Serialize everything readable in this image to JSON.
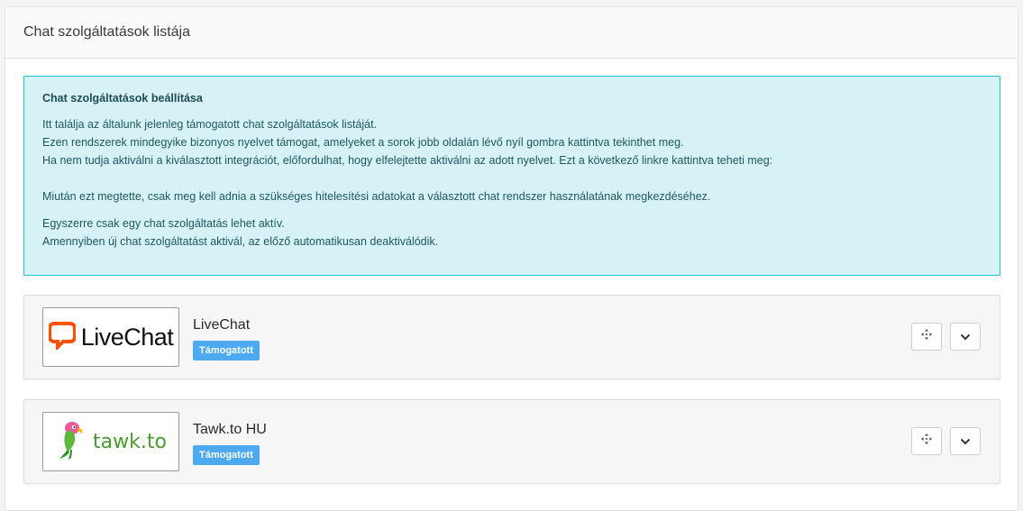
{
  "header": {
    "title": "Chat szolgáltatások listája"
  },
  "info": {
    "title": "Chat szolgáltatások beállítása",
    "paragraph1": [
      "Itt találja az általunk jelenleg támogatott chat szolgáltatások listáját.",
      "Ezen rendszerek mindegyike bizonyos nyelvet támogat, amelyeket a sorok jobb oldalán lévő nyíl gombra kattintva tekinthet meg.",
      "Ha nem tudja aktiválni a kiválasztott integrációt, előfordulhat, hogy elfelejtette aktiválni az adott nyelvet. Ezt a következő linkre kattintva teheti meg:"
    ],
    "paragraph2": "Miután ezt megtette, csak meg kell adnia a szükséges hitelesítési adatokat a választott chat rendszer használatának megkezdéséhez.",
    "paragraph3": [
      "Egyszerre csak egy chat szolgáltatás lehet aktív.",
      "Amennyiben új chat szolgáltatást aktivál, az előző automatikusan deaktiválódik."
    ]
  },
  "services": [
    {
      "name": "LiveChat",
      "badge": "Támogatott",
      "logo_text": "LiveChat",
      "logo_icon": "speech-bubble-icon",
      "brand_color": "#ff5100"
    },
    {
      "name": "Tawk.to HU",
      "badge": "Támogatott",
      "logo_text": "tawk.to",
      "logo_icon": "parrot-icon",
      "brand_color": "#4a9a2e"
    }
  ],
  "colors": {
    "info_background": "#d6f2f6",
    "info_border": "#1fc0cd",
    "badge_background": "#4eaaf0"
  },
  "icons": {
    "move": "move-arrows-icon",
    "toggle": "chevron-down-icon"
  }
}
